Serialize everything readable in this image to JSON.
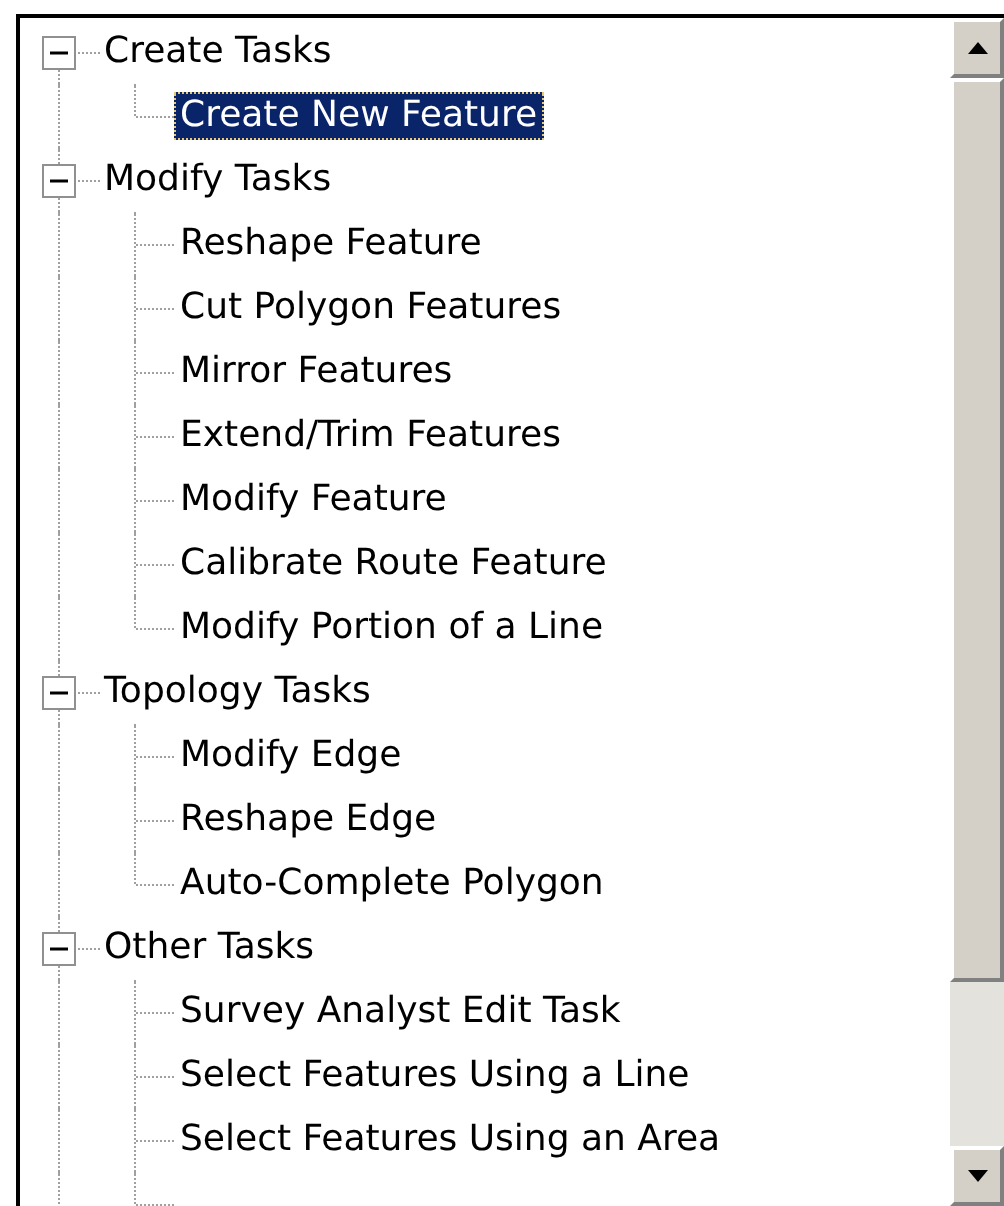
{
  "tree": [
    {
      "label": "Create Tasks",
      "expanded": true,
      "children": [
        {
          "label": "Create New Feature",
          "selected": true
        }
      ]
    },
    {
      "label": "Modify Tasks",
      "expanded": true,
      "children": [
        {
          "label": "Reshape Feature",
          "selected": false
        },
        {
          "label": "Cut Polygon Features",
          "selected": false
        },
        {
          "label": "Mirror Features",
          "selected": false
        },
        {
          "label": "Extend/Trim Features",
          "selected": false
        },
        {
          "label": "Modify Feature",
          "selected": false
        },
        {
          "label": "Calibrate Route Feature",
          "selected": false
        },
        {
          "label": "Modify Portion of a Line",
          "selected": false
        }
      ]
    },
    {
      "label": "Topology Tasks",
      "expanded": true,
      "children": [
        {
          "label": "Modify Edge",
          "selected": false
        },
        {
          "label": "Reshape Edge",
          "selected": false
        },
        {
          "label": "Auto-Complete Polygon",
          "selected": false
        }
      ]
    },
    {
      "label": "Other Tasks",
      "expanded": true,
      "children": [
        {
          "label": "Survey Analyst Edit Task",
          "selected": false
        },
        {
          "label": "Select Features Using a Line",
          "selected": false
        },
        {
          "label": "Select Features Using an Area",
          "selected": false
        }
      ]
    }
  ]
}
